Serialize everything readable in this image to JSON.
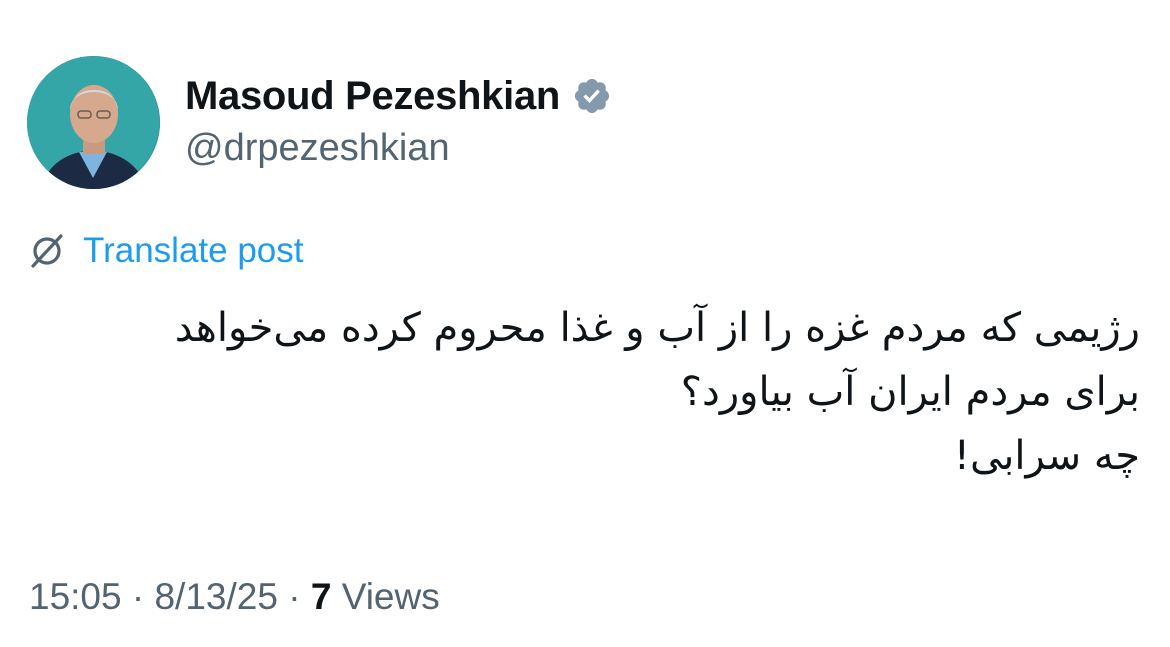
{
  "author": {
    "display_name": "Masoud Pezeshkian",
    "handle": "@drpezeshkian",
    "verified": true,
    "verified_color": "#829aab",
    "avatar_background": "#2e9c9f"
  },
  "translate": {
    "icon": "translate-icon",
    "label": "Translate post",
    "color": "#1d9bf0"
  },
  "post": {
    "lines": [
      "رژیمی که مردم غزه را از آب و غذا محروم کرده می‌خواهد",
      "برای مردم ایران آب بیاورد؟",
      "چه سرابی!"
    ]
  },
  "meta": {
    "time": "15:05",
    "separator": "·",
    "date": "8/13/25",
    "views_count": "7",
    "views_label": "Views"
  }
}
